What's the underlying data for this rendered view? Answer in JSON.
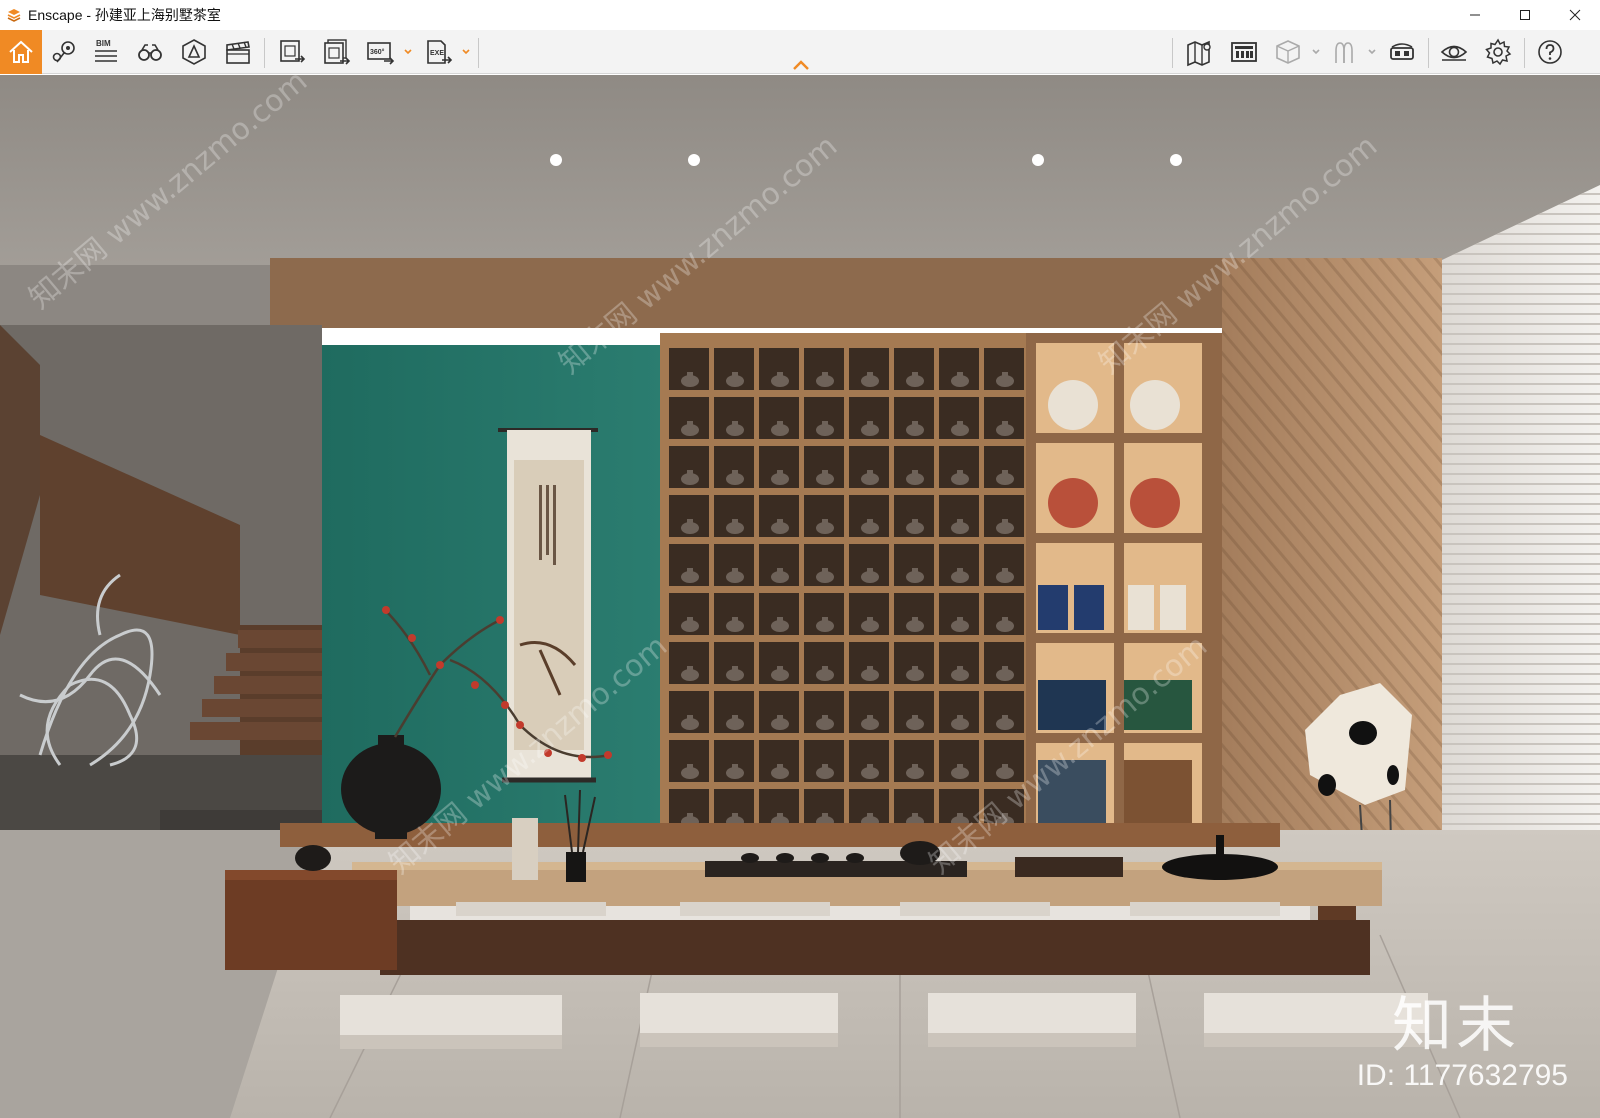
{
  "window": {
    "title": "Enscape - 孙建亚上海别墅茶室",
    "controls": {
      "minimize": "minimize-icon",
      "maximize": "maximize-icon",
      "close": "close-icon"
    }
  },
  "toolbar": {
    "left_group": [
      {
        "name": "home-button",
        "icon": "home-icon",
        "active": true
      },
      {
        "name": "views-button",
        "icon": "location-pins-icon"
      },
      {
        "name": "bim-button",
        "icon": "bim-list-icon",
        "label": "BIM"
      },
      {
        "name": "walk-mode-button",
        "icon": "binoculars-icon"
      },
      {
        "name": "asset-library-button",
        "icon": "asset-library-icon"
      },
      {
        "name": "video-editor-button",
        "icon": "clapperboard-icon"
      }
    ],
    "export_group": [
      {
        "name": "screenshot-button",
        "icon": "render-export-icon"
      },
      {
        "name": "batch-render-button",
        "icon": "batch-render-icon"
      },
      {
        "name": "panorama-button",
        "icon": "panorama-360-icon",
        "label": "360°"
      },
      {
        "name": "exe-export-button",
        "icon": "exe-export-icon",
        "label": "EXE"
      }
    ],
    "right_group": [
      {
        "name": "map-button",
        "icon": "map-icon"
      },
      {
        "name": "material-editor-button",
        "icon": "building-icon"
      },
      {
        "name": "section-cube-button",
        "icon": "cube-icon"
      },
      {
        "name": "people-button",
        "icon": "people-icon"
      },
      {
        "name": "vr-headset-button",
        "icon": "vr-headset-icon"
      },
      {
        "name": "visual-settings-button",
        "icon": "eye-icon"
      },
      {
        "name": "settings-button",
        "icon": "gear-icon"
      },
      {
        "name": "help-button",
        "icon": "help-icon"
      }
    ],
    "accent_color": "#f08a24"
  },
  "viewport": {
    "description_tag": "tea-room-render",
    "watermark_logo": "知末",
    "watermark_id": "ID: 1177632795",
    "diagonal_watermark": "知末网 www.znzmo.com"
  }
}
